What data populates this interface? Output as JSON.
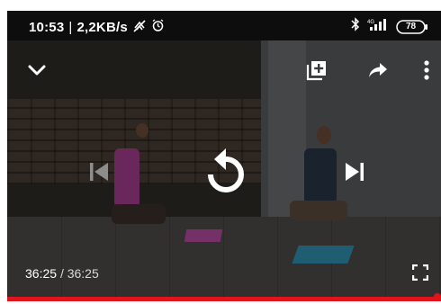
{
  "status_bar": {
    "time": "10:53",
    "separator": "|",
    "network_speed": "2,2KB/s",
    "battery_level": "78",
    "icons": [
      "data-saver-icon",
      "alarm-icon",
      "bluetooth-icon",
      "signal-4g-icon",
      "battery-icon"
    ]
  },
  "player": {
    "elapsed_time": "36:25",
    "time_separator": "/",
    "total_time": "36:25",
    "progress_fraction": 1.0,
    "accent_color": "#e1141c",
    "controls": [
      "collapse-icon",
      "add-to-playlist-icon",
      "share-icon",
      "more-options-icon",
      "previous-icon",
      "replay-icon",
      "next-icon",
      "fullscreen-icon"
    ]
  }
}
